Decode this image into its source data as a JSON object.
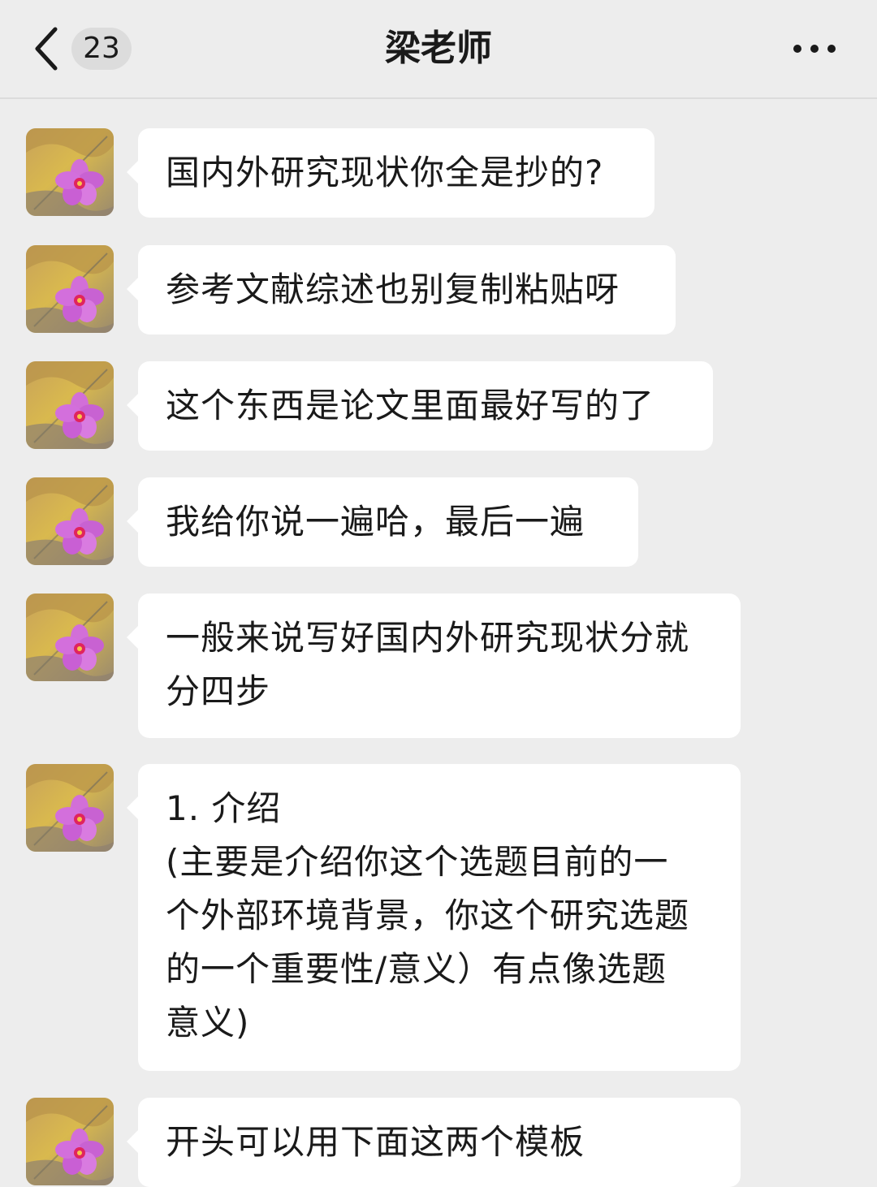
{
  "header": {
    "back_icon": "chevron-left-icon",
    "unread_count": "23",
    "title": "梁老师",
    "more_icon": "more-horizontal-icon"
  },
  "messages": [
    {
      "text": "国内外研究现状你全是抄的?"
    },
    {
      "text": "参考文献综述也别复制粘贴呀"
    },
    {
      "text": "这个东西是论文里面最好写的了"
    },
    {
      "text": "我给你说一遍哈，最后一遍"
    },
    {
      "lines": [
        "一般来说写好国内外研究现状分就",
        "分四步"
      ]
    },
    {
      "lines": [
        "1. 介绍",
        "(主要是介绍你这个选题目前的一",
        "个外部环境背景，你这个研究选题",
        "的一个重要性/意义）有点像选题",
        "意义)"
      ]
    },
    {
      "text": "开头可以用下面这两个模板"
    }
  ]
}
